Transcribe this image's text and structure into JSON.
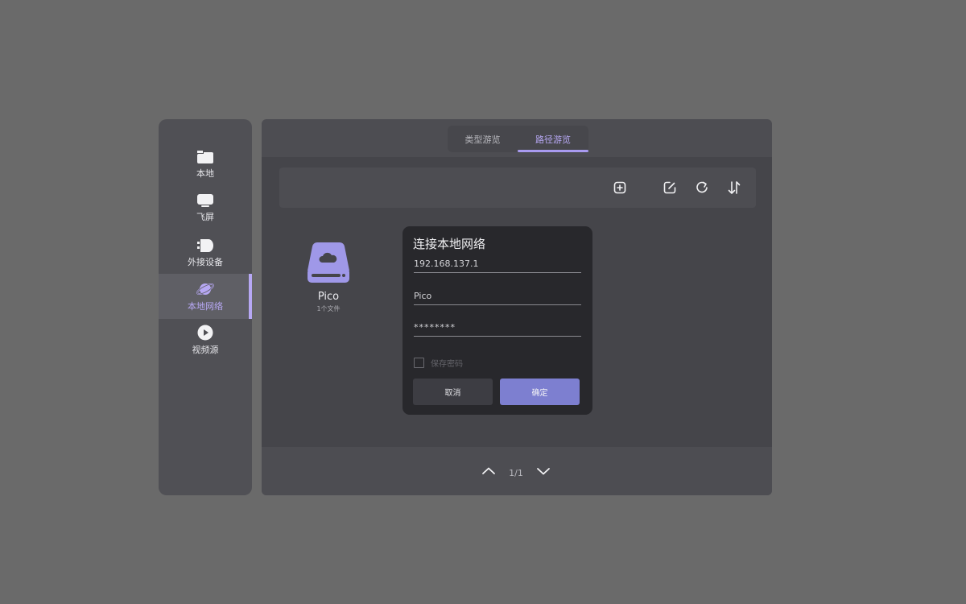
{
  "sidebar": {
    "items": [
      {
        "label": "本地",
        "icon": "folder-icon"
      },
      {
        "label": "飞屏",
        "icon": "screen-icon"
      },
      {
        "label": "外接设备",
        "icon": "usb-drive-icon"
      },
      {
        "label": "本地网络",
        "icon": "planet-icon",
        "active": true
      },
      {
        "label": "视频源",
        "icon": "play-icon"
      }
    ]
  },
  "tabs": [
    {
      "label": "类型游览"
    },
    {
      "label": "路径游览",
      "active": true
    }
  ],
  "files": [
    {
      "name": "Pico",
      "meta": "1个文件",
      "icon": "network-drive-icon"
    }
  ],
  "pager": {
    "text": "1/1"
  },
  "dialog": {
    "title": "连接本地网络",
    "address": "192.168.137.1",
    "username": "Pico",
    "password": "********",
    "save_password_label": "保存密码",
    "cancel_label": "取消",
    "ok_label": "确定"
  },
  "colors": {
    "accent": "#b7a8f4",
    "ok_button": "#7d7fd0",
    "background": "#6a6a6a"
  }
}
